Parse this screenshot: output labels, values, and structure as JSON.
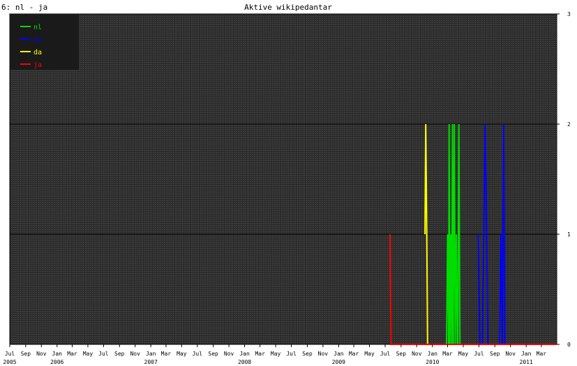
{
  "header": {
    "corner_label": "6: nl - ja",
    "title": "Aktive wikipedantar"
  },
  "chart_data": {
    "type": "line",
    "title": "Aktive wikipedantar",
    "x_range": [
      "2005-07",
      "2011-04"
    ],
    "ylim": [
      0,
      3
    ],
    "y_ticks": [
      "0",
      "1",
      "2",
      "3"
    ],
    "y_axis_side": "right",
    "grid": true,
    "legend_position": "top-left",
    "month_ticks": [
      "Jul",
      "Sep",
      "Nov",
      "Jan",
      "Mar",
      "May",
      "Jul",
      "Sep",
      "Nov",
      "Jan",
      "Mar",
      "May",
      "Jul",
      "Sep",
      "Nov",
      "Jan",
      "Mar",
      "May",
      "Jul",
      "Sep",
      "Nov",
      "Jan",
      "Mar",
      "May",
      "Jul",
      "Sep",
      "Nov",
      "Jan",
      "Mar",
      "May",
      "Jul",
      "Sep",
      "Nov",
      "Jan",
      "Mar"
    ],
    "year_ticks": [
      "2005",
      "2006",
      "2007",
      "2008",
      "2009",
      "2010",
      "2011"
    ],
    "series": [
      {
        "name": "nl",
        "color": "#00dd00",
        "points": [
          [
            "2010-02-25",
            0
          ],
          [
            "2010-03-01",
            1
          ],
          [
            "2010-03-05",
            0
          ],
          [
            "2010-03-07",
            2
          ],
          [
            "2010-03-10",
            0
          ],
          [
            "2010-03-14",
            1
          ],
          [
            "2010-03-17",
            0
          ],
          [
            "2010-03-20",
            2
          ],
          [
            "2010-03-23",
            0
          ],
          [
            "2010-03-27",
            2
          ],
          [
            "2010-03-31",
            0
          ],
          [
            "2010-04-04",
            1
          ],
          [
            "2010-04-08",
            0
          ],
          [
            "2010-04-10",
            0
          ],
          [
            "2010-04-14",
            2
          ],
          [
            "2010-04-18",
            0
          ]
        ]
      },
      {
        "name": "nn",
        "color": "#0000ff",
        "points": [
          [
            "2010-06-28",
            1
          ],
          [
            "2010-07-05",
            0
          ],
          [
            "2010-07-14",
            0
          ],
          [
            "2010-07-20",
            1
          ],
          [
            "2010-07-25",
            2
          ],
          [
            "2010-07-31",
            1
          ],
          [
            "2010-08-05",
            0
          ],
          [
            "2010-09-20",
            0
          ],
          [
            "2010-09-25",
            1
          ],
          [
            "2010-09-30",
            0
          ],
          [
            "2010-10-05",
            2
          ],
          [
            "2010-10-10",
            0
          ]
        ]
      },
      {
        "name": "da",
        "color": "#ffff00",
        "points": [
          [
            "2009-12-03",
            1
          ],
          [
            "2009-12-06",
            2
          ],
          [
            "2009-12-10",
            1
          ],
          [
            "2009-12-13",
            0
          ]
        ]
      },
      {
        "name": "ja",
        "color": "#ff0000",
        "points": [
          [
            "2009-07-20",
            1
          ],
          [
            "2009-07-24",
            0
          ],
          [
            "2011-04-30",
            0
          ]
        ]
      }
    ]
  }
}
